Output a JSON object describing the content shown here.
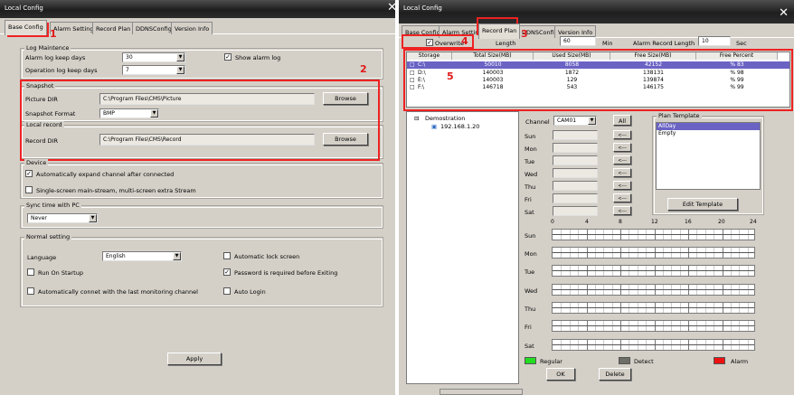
{
  "left_window": {
    "title": "Local Config",
    "close": "✕",
    "tabs": [
      "Base Config",
      "Alarm Setting",
      "Record Plan",
      "DDNSConfig",
      "Version Info"
    ],
    "log": {
      "group": "Log Maintence",
      "alarm_label": "Alarm log keep days",
      "alarm_value": "30",
      "op_label": "Operation log keep days",
      "op_value": "7",
      "show_alarm_log": "Show alarm log"
    },
    "snapshot": {
      "group": "Snapshot",
      "picture_dir_label": "Picture DIR",
      "picture_dir": "C:\\Program Files\\CMS\\Picture",
      "browse": "Browse",
      "format_label": "Snapshot Format",
      "format_value": "BMP"
    },
    "localrecord": {
      "group": "Local record",
      "record_dir_label": "Record DIR",
      "record_dir": "C:\\Program Files\\CMS\\Record",
      "browse": "Browse"
    },
    "device": {
      "group": "Device",
      "auto_expand": "Automatically expand channel after connected",
      "single_screen": "Single-screen main-stream, multi-screen extra Stream"
    },
    "sync": {
      "group": "Sync time with PC",
      "value": "Never"
    },
    "normal": {
      "group": "Normal setting",
      "language_label": "Language",
      "language_value": "English",
      "auto_lock": "Automatic lock screen",
      "run_startup": "Run On Startup",
      "password_exit": "Password is required before Exiting",
      "auto_connect": "Automatically connet with the last monitoring channel",
      "auto_login": "Auto Login"
    },
    "apply": "Apply"
  },
  "right_window": {
    "title": "Local Config",
    "close": "✕",
    "tabs": [
      "Base Config",
      "Alarm Setting",
      "Record Plan",
      "DDNSConfig",
      "Version Info"
    ],
    "overwrite": "Overwrite",
    "length_label": "Length",
    "length_value": "60",
    "min": "Min",
    "alarm_len_label": "Alarm Record Length",
    "alarm_len_value": "10",
    "sec": "Sec",
    "storage": {
      "headers": [
        "Storage",
        "Total Size(MB)",
        "Used Size(MB)",
        "Free Size(MB)",
        "Free Percent"
      ],
      "rows": [
        [
          "C:\\",
          "50010",
          "8058",
          "42152",
          "% 83"
        ],
        [
          "D:\\",
          "140003",
          "1872",
          "138131",
          "% 98"
        ],
        [
          "E:\\",
          "140003",
          "129",
          "139874",
          "% 99"
        ],
        [
          "F:\\",
          "146718",
          "543",
          "146175",
          "% 99"
        ]
      ]
    },
    "tree": {
      "root": "Demostration",
      "device": "192.168.1.20"
    },
    "channel_label": "Channel",
    "channel_value": "CAM01",
    "all_button": "All",
    "arrow": "<---",
    "days": [
      "Sun",
      "Mon",
      "Tue",
      "Wed",
      "Thu",
      "Fri",
      "Sat"
    ],
    "plan_template": {
      "group": "Plan Template",
      "items": [
        "AllDay",
        "Empty"
      ]
    },
    "edit_template": "Edit Template",
    "hours": [
      "0",
      "4",
      "8",
      "12",
      "16",
      "20",
      "24"
    ],
    "legend": {
      "regular": "Regular",
      "detect": "Detect",
      "alarm": "Alarm",
      "regular_color": "#22dd22",
      "detect_color": "#6e6e68",
      "alarm_color": "#ee1111"
    },
    "ok": "OK",
    "delete": "Delete"
  },
  "annotations": [
    "1",
    "2",
    "3",
    "4",
    "5"
  ],
  "colors": {
    "selection": "#6a63c4",
    "annotation": "#ee2222"
  }
}
